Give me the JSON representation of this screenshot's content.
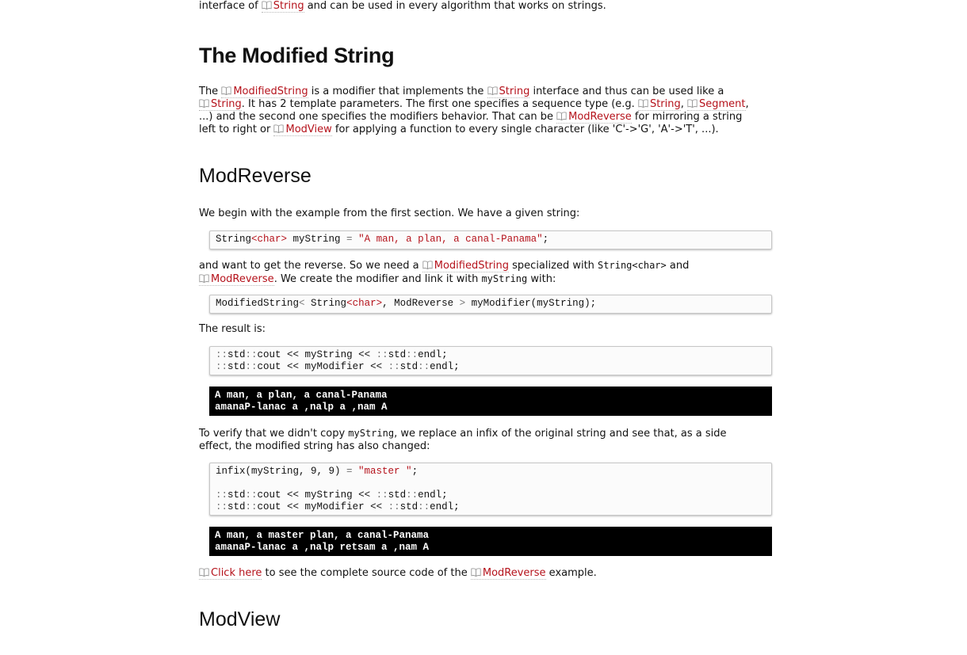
{
  "intro": {
    "pre": "interface of ",
    "link": "String",
    "post": " and can be used in every algorithm that works on strings."
  },
  "section_modified": {
    "title": "The Modified String",
    "p1": {
      "t1": "The ",
      "l1": "ModifiedString",
      "t2": " is a modifier that implements the ",
      "l2": "String",
      "t3": " interface and thus can be used like a",
      "l3": "String",
      "t4": ". It has 2 template parameters. The first one specifies a sequence type (e.g. ",
      "l4": "String",
      "t5": ", ",
      "l5": "Segment",
      "t6": ",",
      "t7": "...) and the second one specifies the modifiers behavior. That can be ",
      "l6": "ModReverse",
      "t8": " for mirroring a string",
      "t9": "left to right or ",
      "l7": "ModView",
      "t10": " for applying a function to every single character (like 'C'->'G', 'A'->'T', ...)."
    }
  },
  "section_reverse": {
    "title": "ModReverse",
    "p1": "We begin with the example from the first section. We have a given string:",
    "code1": {
      "a": "String",
      "b": "<char>",
      "c": " myString ",
      "d": "=",
      "e": " \"A man, a plan, a canal-Panama\"",
      "f": ";"
    },
    "p2": {
      "t1": "and want to get the reverse. So we need a ",
      "l1": "ModifiedString",
      "t2": " specialized with ",
      "c1": "String<char>",
      "t3": " and",
      "l2": "ModReverse",
      "t4": ". We create the modifier and link it with ",
      "c2": "myString",
      "t5": " with:"
    },
    "code2": {
      "a": "ModifiedString",
      "b": "<",
      "c": " String",
      "d": "<char>",
      "e": ", ModReverse ",
      "f": ">",
      "g": " myModifier(myString);"
    },
    "p3": "The result is:",
    "code3": {
      "l1a": "::",
      "l1b": "std",
      "l1c": "::",
      "l1d": "cout << myString << ",
      "l1e": "::",
      "l1f": "std",
      "l1g": "::",
      "l1h": "endl;",
      "l2a": "::",
      "l2b": "std",
      "l2c": "::",
      "l2d": "cout << myModifier << ",
      "l2e": "::",
      "l2f": "std",
      "l2g": "::",
      "l2h": "endl;"
    },
    "out1": {
      "l1": "A man, a plan, a canal-Panama",
      "l2": "amanaP-lanac a ,nalp a ,nam A"
    },
    "p4": {
      "t1": "To verify that we didn't copy ",
      "c1": "myString",
      "t2": ", we replace an infix of the original string and see that, as a side",
      "t3": "effect, the modified string has also changed:"
    },
    "code4": {
      "a": "infix(myString, 9, 9) ",
      "b": "=",
      "c": " \"master \"",
      "d": ";",
      "l2a": "::",
      "l2b": "std",
      "l2c": "::",
      "l2d": "cout << myString << ",
      "l2e": "::",
      "l2f": "std",
      "l2g": "::",
      "l2h": "endl;",
      "l3a": "::",
      "l3b": "std",
      "l3c": "::",
      "l3d": "cout << myModifier << ",
      "l3e": "::",
      "l3f": "std",
      "l3g": "::",
      "l3h": "endl;"
    },
    "out2": {
      "l1": "A man, a master plan, a canal-Panama",
      "l2": "amanaP-lanac a ,nalp retsam a ,nam A"
    },
    "p5": {
      "l1": "Click here",
      "t1": " to see the complete source code of the ",
      "l2": "ModReverse",
      "t2": " example."
    }
  },
  "section_view": {
    "title": "ModView"
  },
  "colors": {
    "link": "#b5121b",
    "code_string": "#b5121b",
    "output_bg": "#000000"
  },
  "icons": {
    "link_icon": "open-book-icon"
  }
}
